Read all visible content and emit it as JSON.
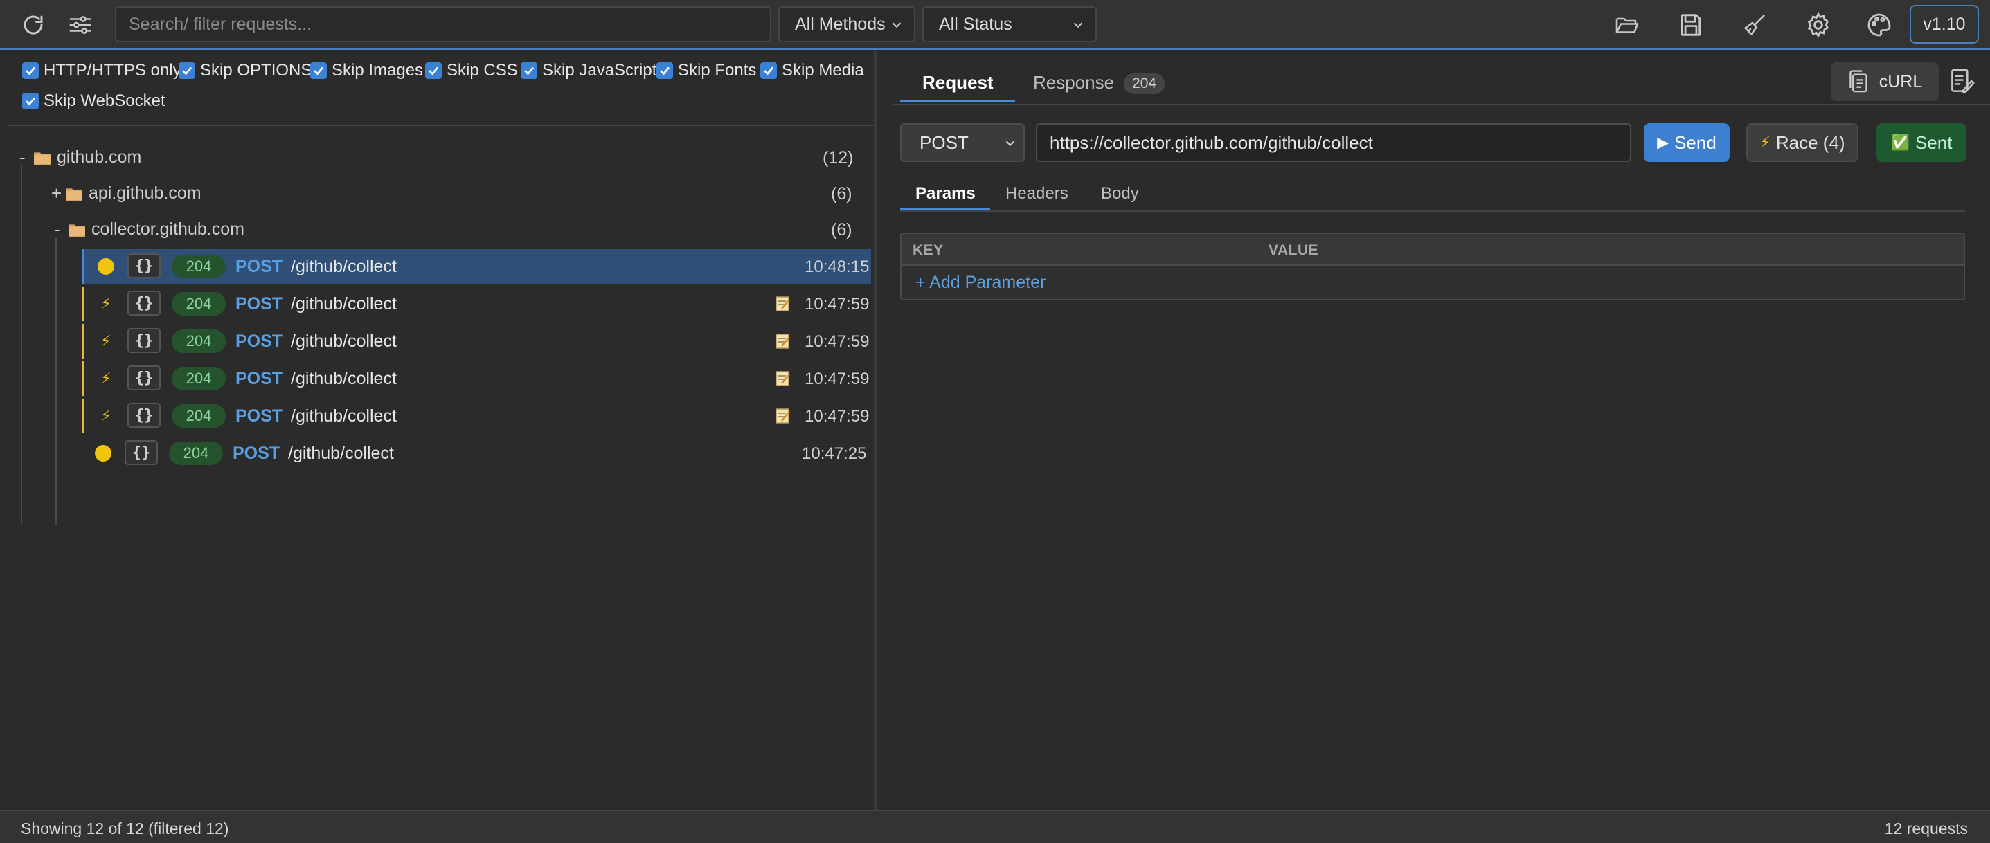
{
  "toolbar": {
    "search_placeholder": "Search/ filter requests...",
    "methods_filter": "All Methods",
    "status_filter": "All Status",
    "version": "v1.10",
    "icons": [
      "refresh-icon",
      "sliders-icon",
      "folder-open-icon",
      "save-icon",
      "broom-icon",
      "gear-icon",
      "palette-icon"
    ]
  },
  "filters": [
    {
      "label": "HTTP/HTTPS only",
      "checked": true
    },
    {
      "label": "Skip OPTIONS",
      "checked": true
    },
    {
      "label": "Skip Images",
      "checked": true
    },
    {
      "label": "Skip CSS",
      "checked": true
    },
    {
      "label": "Skip JavaScript",
      "checked": true
    },
    {
      "label": "Skip Fonts",
      "checked": true
    },
    {
      "label": "Skip Media",
      "checked": true
    },
    {
      "label": "Skip WebSocket",
      "checked": true
    }
  ],
  "tree": {
    "root": {
      "toggle": "-",
      "host": "github.com",
      "count": "(12)"
    },
    "children": [
      {
        "toggle": "+",
        "host": "api.github.com",
        "count": "(6)"
      },
      {
        "toggle": "-",
        "host": "collector.github.com",
        "count": "(6)"
      }
    ],
    "requests": [
      {
        "lead": "dot",
        "type": "{}",
        "status": "204",
        "method": "POST",
        "path": "/github/collect",
        "time": "10:48:15",
        "note": false,
        "selected": true,
        "race": false
      },
      {
        "lead": "bolt",
        "type": "{}",
        "status": "204",
        "method": "POST",
        "path": "/github/collect",
        "time": "10:47:59",
        "note": true,
        "selected": false,
        "race": true
      },
      {
        "lead": "bolt",
        "type": "{}",
        "status": "204",
        "method": "POST",
        "path": "/github/collect",
        "time": "10:47:59",
        "note": true,
        "selected": false,
        "race": true
      },
      {
        "lead": "bolt",
        "type": "{}",
        "status": "204",
        "method": "POST",
        "path": "/github/collect",
        "time": "10:47:59",
        "note": true,
        "selected": false,
        "race": true
      },
      {
        "lead": "bolt",
        "type": "{}",
        "status": "204",
        "method": "POST",
        "path": "/github/collect",
        "time": "10:47:59",
        "note": true,
        "selected": false,
        "race": true
      },
      {
        "lead": "dot",
        "type": "{}",
        "status": "204",
        "method": "POST",
        "path": "/github/collect",
        "time": "10:47:25",
        "note": false,
        "selected": false,
        "race": false
      }
    ]
  },
  "right": {
    "tabs": {
      "request": "Request",
      "response": "Response",
      "response_status": "204"
    },
    "curl_label": "cURL",
    "method": "POST",
    "url": "https://collector.github.com/github/collect",
    "send_label": "Send",
    "send_icon": "▶",
    "race_label": "Race (4)",
    "race_icon": "⚡",
    "sent_label": "Sent",
    "sent_icon": "✅",
    "subtabs": {
      "params": "Params",
      "headers": "Headers",
      "body": "Body"
    },
    "params_table": {
      "key_header": "KEY",
      "value_header": "VALUE",
      "add_label": "+ Add Parameter"
    }
  },
  "statusbar": {
    "left": "Showing 12 of 12 (filtered 12)",
    "right": "12 requests"
  },
  "colors": {
    "accent": "#4a8ad8",
    "status_ok_bg": "#24532e",
    "status_ok_fg": "#8fd49c",
    "race": "#e8b53a",
    "dot": "#f1c40f"
  }
}
